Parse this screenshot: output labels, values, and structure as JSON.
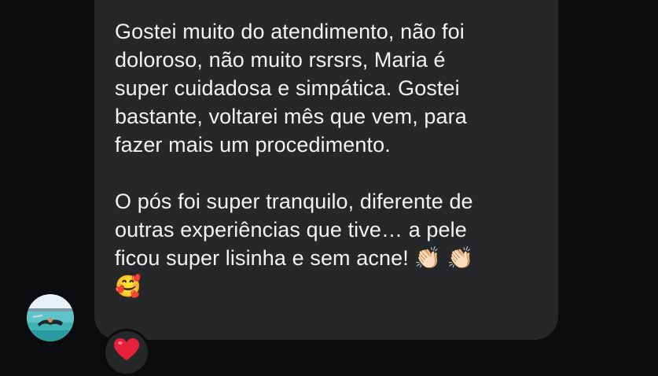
{
  "message": {
    "paragraph_1": "Gostei muito do atendimento, não foi\ndoloroso, não muito rsrsrs,  Maria é\nsuper cuidadosa e simpática. Gostei\nbastante, voltarei mês que vem, para\nfazer mais um procedimento.",
    "paragraph_2": "O pós foi super tranquilo, diferente de\noutras experiências que tive… a pele\nficou super lisinha e sem acne! ",
    "emoji_clap_1": "👏🏻",
    "emoji_clap_2": "👏🏻",
    "emoji_smiling_hearts": "🥰"
  },
  "reaction": {
    "emoji": "❤️"
  },
  "avatar": {
    "icon": "sender-avatar-beach-photo"
  },
  "colors": {
    "background": "#0b0c0e",
    "bubble": "#262729",
    "text": "#f2f2f4",
    "heart": "#e8213a"
  }
}
